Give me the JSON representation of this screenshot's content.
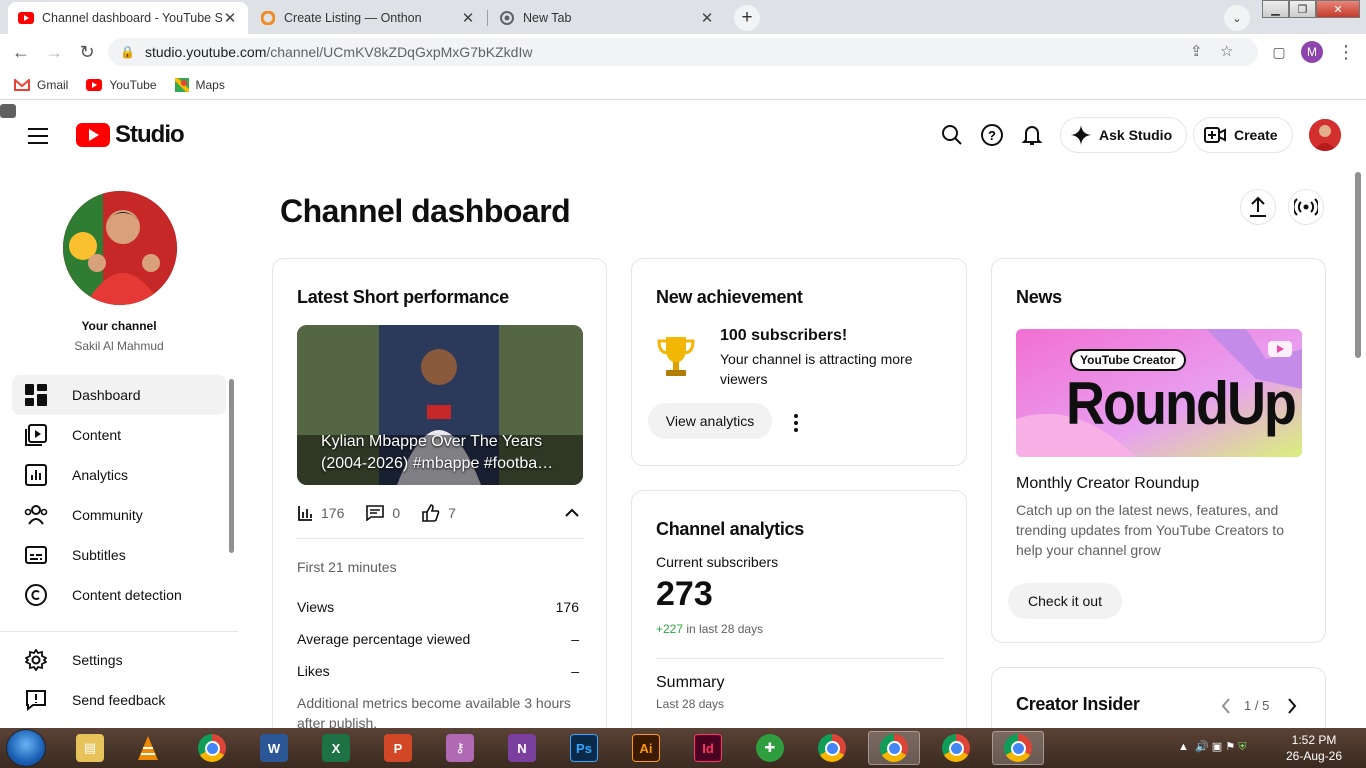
{
  "browser": {
    "tabs": [
      {
        "title": "Channel dashboard - YouTube Studio",
        "active": true
      },
      {
        "title": "Create Listing — Onthon",
        "active": false
      },
      {
        "title": "New Tab",
        "active": false
      }
    ],
    "url_host": "studio.youtube.com",
    "url_path": "/channel/UCmKV8kZDqGxpMxG7bKZkdIw",
    "profile_initial": "M",
    "bookmarks": [
      "Gmail",
      "YouTube",
      "Maps"
    ]
  },
  "header": {
    "logo_text": "Studio",
    "ask_studio": "Ask Studio",
    "create": "Create"
  },
  "sidebar": {
    "your_channel": "Your channel",
    "channel_name": "Sakil Al Mahmud",
    "items": [
      {
        "label": "Dashboard",
        "icon": "dashboard-icon",
        "active": true
      },
      {
        "label": "Content",
        "icon": "content-icon"
      },
      {
        "label": "Analytics",
        "icon": "analytics-icon"
      },
      {
        "label": "Community",
        "icon": "community-icon"
      },
      {
        "label": "Subtitles",
        "icon": "subtitles-icon"
      },
      {
        "label": "Content detection",
        "icon": "copyright-icon"
      }
    ],
    "bottom_items": [
      {
        "label": "Settings",
        "icon": "gear-icon"
      },
      {
        "label": "Send feedback",
        "icon": "feedback-icon"
      }
    ]
  },
  "main": {
    "title": "Channel dashboard",
    "latest_short": {
      "title": "Latest Short performance",
      "video_title": "Kylian Mbappe Over The Years (2004-2026) #mbappe #footba…",
      "views": "176",
      "comments": "0",
      "likes": "7",
      "period": "First 21 minutes",
      "metrics": [
        {
          "label": "Views",
          "value": "176"
        },
        {
          "label": "Average percentage viewed",
          "value": "–"
        },
        {
          "label": "Likes",
          "value": "–"
        }
      ],
      "note": "Additional metrics become available 3 hours after publish."
    },
    "achievement": {
      "title": "New achievement",
      "headline": "100 subscribers!",
      "text": "Your channel is attracting more viewers",
      "button": "View analytics"
    },
    "channel_analytics": {
      "title": "Channel analytics",
      "subs_label": "Current subscribers",
      "subs_value": "273",
      "change": "+227",
      "change_suffix": " in last 28 days",
      "summary": "Summary",
      "summary_sub": "Last 28 days"
    },
    "news": {
      "title": "News",
      "banner_tag": "YouTube Creator",
      "banner_text": "RoundUp",
      "headline": "Monthly Creator Roundup",
      "text": "Catch up on the latest news, features, and trending updates from YouTube Creators to help your channel grow",
      "button": "Check it out"
    },
    "creator_insider": {
      "title": "Creator Insider",
      "pager": "1 / 5"
    }
  },
  "taskbar": {
    "time": "1:52 PM",
    "date": "26-Aug-26"
  }
}
